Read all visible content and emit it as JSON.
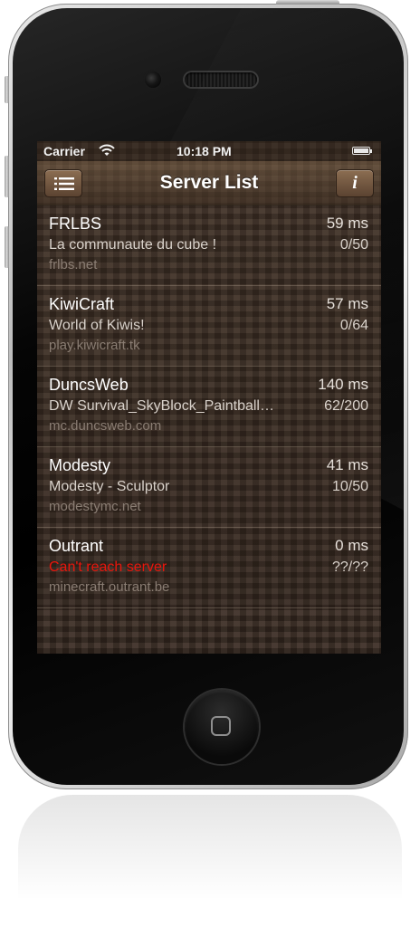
{
  "status_bar": {
    "carrier": "Carrier",
    "time": "10:18 PM",
    "wifi_icon": "wifi-icon",
    "battery_icon": "battery-full-icon"
  },
  "nav": {
    "title": "Server List",
    "left_button_icon": "list-menu-icon",
    "right_button_icon": "info-icon",
    "info_glyph": "i"
  },
  "servers": [
    {
      "name": "FRLBS",
      "ping": "59 ms",
      "motd": "La communaute du cube !",
      "players": "0/50",
      "host": "frlbs.net",
      "error": false
    },
    {
      "name": "KiwiCraft",
      "ping": "57 ms",
      "motd": "World of Kiwis!",
      "players": "0/64",
      "host": "play.kiwicraft.tk",
      "error": false
    },
    {
      "name": "DuncsWeb",
      "ping": "140 ms",
      "motd": "DW Survival_SkyBlock_Paintball…",
      "players": "62/200",
      "host": "mc.duncsweb.com",
      "error": false
    },
    {
      "name": "Modesty",
      "ping": "41 ms",
      "motd": "Modesty - Sculptor",
      "players": "10/50",
      "host": "modestymc.net",
      "error": false
    },
    {
      "name": "Outrant",
      "ping": "0 ms",
      "motd": "Can't reach server",
      "players": "??/??",
      "host": "minecraft.outrant.be",
      "error": true
    }
  ],
  "colors": {
    "error_text": "#e8160c",
    "title_text": "#ffffff",
    "host_text": "#8a7d73"
  }
}
